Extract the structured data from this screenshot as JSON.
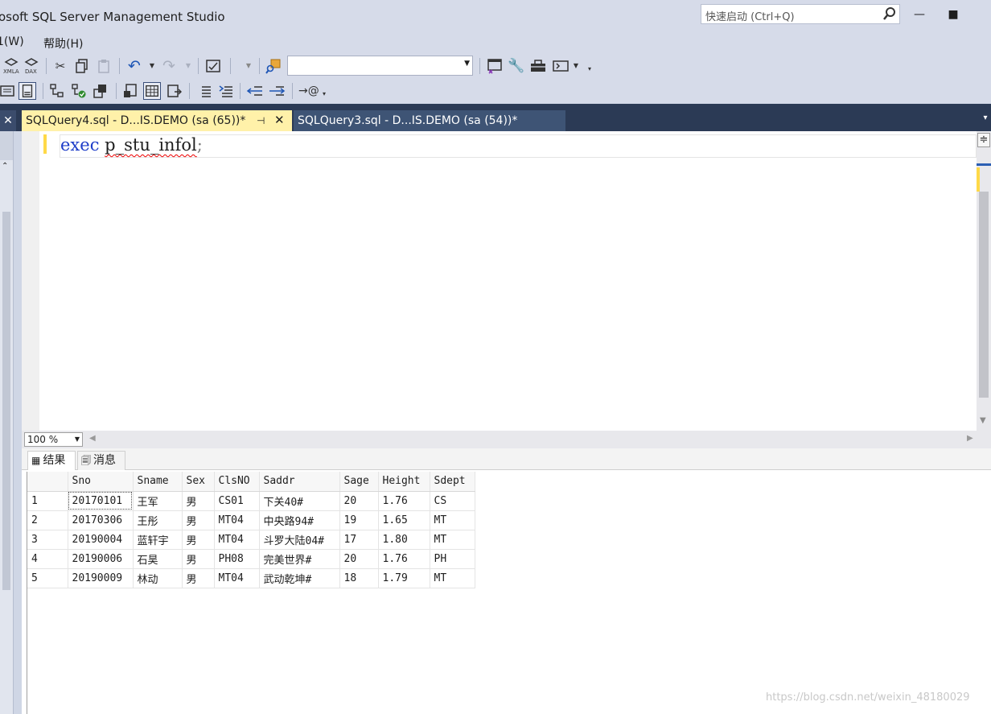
{
  "app": {
    "title": "osoft SQL Server Management Studio"
  },
  "quick_launch": {
    "placeholder": "快速启动 (Ctrl+Q)",
    "icon": "search-icon"
  },
  "window_controls": {
    "minimize": "—",
    "maximize": "■"
  },
  "menu": {
    "items": [
      "1(W)",
      "帮助(H)"
    ]
  },
  "toolbar1": {
    "icons": [
      "xmla-icon",
      "dax-icon",
      "cut-icon",
      "copy-icon",
      "paste-icon",
      "undo-icon",
      "redo-icon",
      "properties-icon",
      "find-icon",
      "solution-icon",
      "wrench-icon",
      "toolbox-icon",
      "console-icon"
    ],
    "xmla_label": "XMLA",
    "dax_label": "DAX",
    "combo_value": ""
  },
  "toolbar2": {
    "icons": [
      "results-text-icon",
      "results-grid-icon",
      "results-file-icon",
      "plan-icon",
      "client-stats-icon",
      "comment-icon",
      "uncomment-icon",
      "outdent-icon",
      "indent-icon",
      "specify-values-icon"
    ]
  },
  "tabs": [
    {
      "label": "SQLQuery4.sql - D...IS.DEMO (sa (65))*",
      "active": true,
      "pin": "⊣",
      "close": "✕"
    },
    {
      "label": "SQLQuery3.sql - D...IS.DEMO (sa (54))*",
      "active": false
    }
  ],
  "editor": {
    "keyword": "exec",
    "procedure": "p_stu_infol",
    "terminator": ";",
    "zoom": "100 %"
  },
  "results": {
    "tabs": [
      {
        "label": "结果",
        "icon": "grid-icon"
      },
      {
        "label": "消息",
        "icon": "messages-icon"
      }
    ],
    "columns": [
      "Sno",
      "Sname",
      "Sex",
      "ClsNO",
      "Saddr",
      "Sage",
      "Height",
      "Sdept"
    ],
    "rows": [
      {
        "num": "1",
        "cells": [
          "20170101",
          "王军",
          "男",
          "CS01",
          "下关40#",
          "20",
          "1.76",
          "CS"
        ]
      },
      {
        "num": "2",
        "cells": [
          "20170306",
          "王彤",
          "男",
          "MT04",
          "中央路94#",
          "19",
          "1.65",
          "MT"
        ]
      },
      {
        "num": "3",
        "cells": [
          "20190004",
          "蓝轩宇",
          "男",
          "MT04",
          "斗罗大陆04#",
          "17",
          "1.80",
          "MT"
        ]
      },
      {
        "num": "4",
        "cells": [
          "20190006",
          "石昊",
          "男",
          "PH08",
          "完美世界#",
          "20",
          "1.76",
          "PH"
        ]
      },
      {
        "num": "5",
        "cells": [
          "20190009",
          "林动",
          "男",
          "MT04",
          "武动乾坤#",
          "18",
          "1.79",
          "MT"
        ]
      }
    ]
  },
  "watermark": "https://blog.csdn.net/weixin_48180029",
  "colors": {
    "accent_tab": "#fff1a9",
    "dark_band": "#2b3a55",
    "keyword": "#1d3cc8"
  }
}
